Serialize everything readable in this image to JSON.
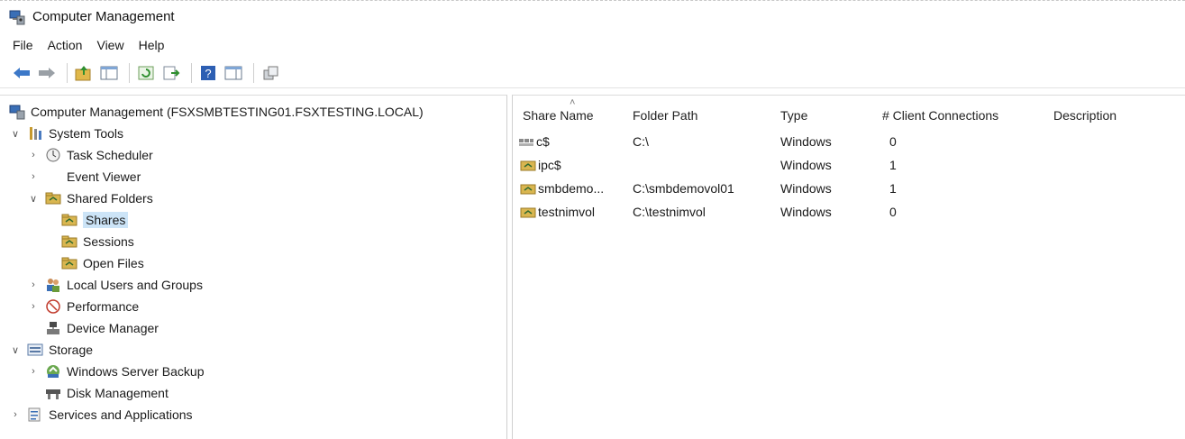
{
  "window": {
    "title": "Computer Management"
  },
  "menu": [
    "File",
    "Action",
    "View",
    "Help"
  ],
  "toolbar": {
    "buttons": [
      "back-icon",
      "forward-icon",
      "up-folder-icon",
      "show-hide-tree-icon",
      "refresh-icon",
      "export-list-icon",
      "help-icon",
      "show-hide-action-pane-icon",
      "properties-icon"
    ]
  },
  "tree": {
    "root": "Computer Management (FSXSMBTESTING01.FSXTESTING.LOCAL)",
    "system_tools": "System Tools",
    "task_scheduler": "Task Scheduler",
    "event_viewer": "Event Viewer",
    "shared_folders": "Shared Folders",
    "shares": "Shares",
    "sessions": "Sessions",
    "open_files": "Open Files",
    "local_users": "Local Users and Groups",
    "performance": "Performance",
    "device_manager": "Device Manager",
    "storage": "Storage",
    "windows_server_backup": "Windows Server Backup",
    "disk_management": "Disk Management",
    "services_apps": "Services and Applications"
  },
  "list": {
    "columns": [
      "Share Name",
      "Folder Path",
      "Type",
      "# Client Connections",
      "Description"
    ],
    "rows": [
      {
        "name": "c$",
        "path": "C:\\",
        "type": "Windows",
        "connections": "0",
        "description": ""
      },
      {
        "name": "ipc$",
        "path": "",
        "type": "Windows",
        "connections": "1",
        "description": ""
      },
      {
        "name": "smbdemo...",
        "path": "C:\\smbdemovol01",
        "type": "Windows",
        "connections": "1",
        "description": ""
      },
      {
        "name": "testnimvol",
        "path": "C:\\testnimvol",
        "type": "Windows",
        "connections": "0",
        "description": ""
      }
    ]
  },
  "colors": {
    "selection": "#cce4f7",
    "folder": "#d9b650",
    "accent": "#2b6cc4"
  }
}
